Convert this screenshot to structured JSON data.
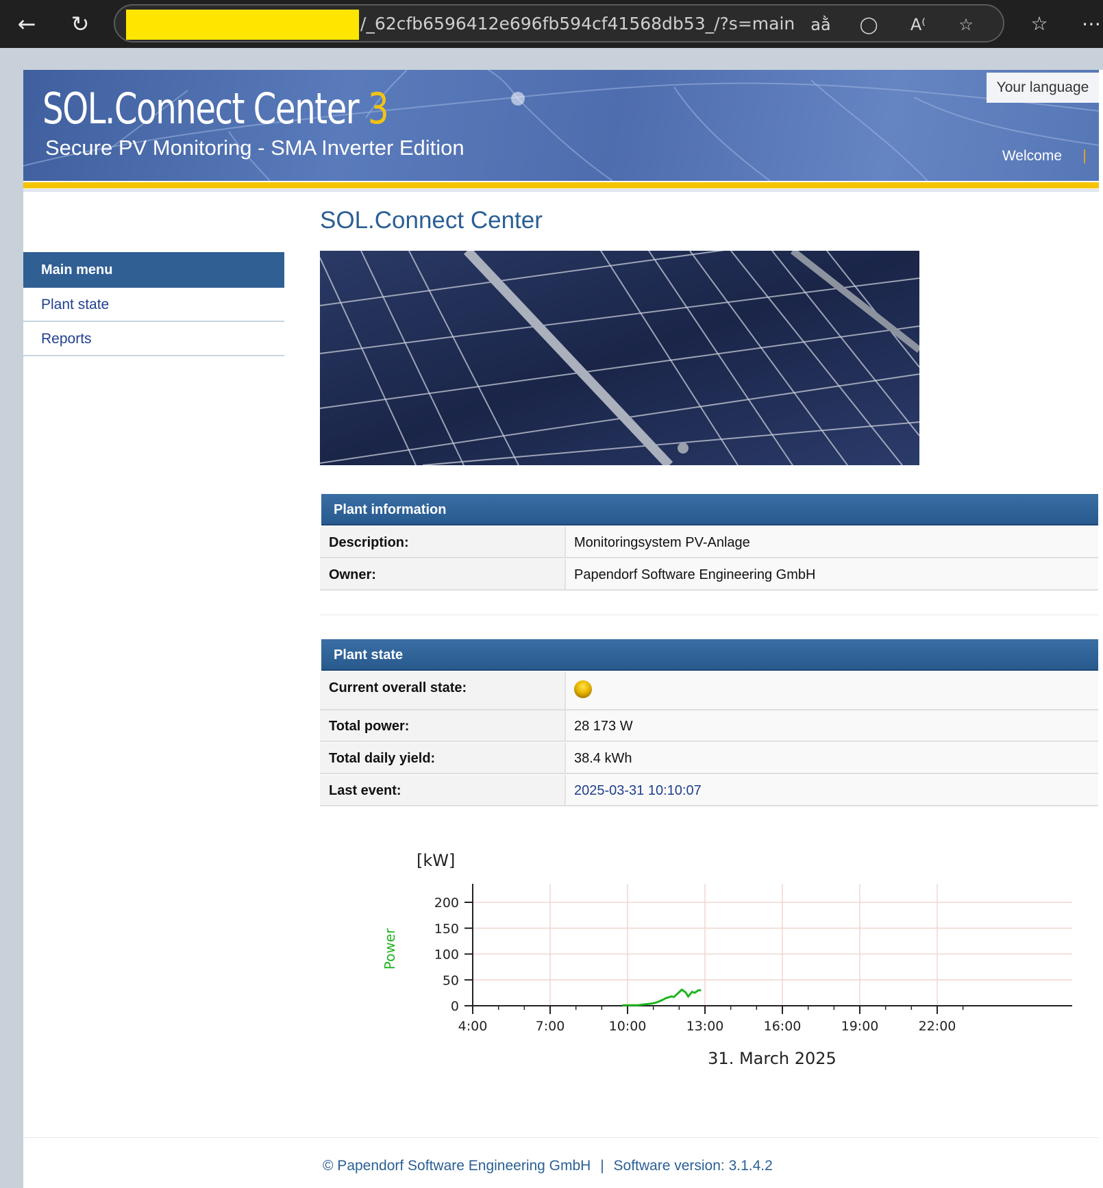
{
  "browser": {
    "url_visible": "/_62cfb6596412e696fb594cf41568db53_/?s=main",
    "url_redacted_color": "#ffe600"
  },
  "header": {
    "brand": "SOL.Connect Center ",
    "brand_version": "3",
    "tagline": "Secure PV Monitoring - SMA Inverter Edition",
    "language_button": "Your language",
    "welcome": "Welcome",
    "welcome_separator": "|"
  },
  "sidebar": {
    "title": "Main menu",
    "items": [
      {
        "label": "Plant state"
      },
      {
        "label": "Reports"
      }
    ]
  },
  "main": {
    "title": "SOL.Connect Center",
    "plant_information": {
      "heading": "Plant information",
      "rows": [
        {
          "label": "Description:",
          "value": "Monitoringsystem PV-Anlage"
        },
        {
          "label": "Owner:",
          "value": "Papendorf Software Engineering GmbH"
        }
      ]
    },
    "plant_state": {
      "heading": "Plant state",
      "rows": [
        {
          "label": "Current overall state:",
          "status_color": "#e9b400"
        },
        {
          "label": "Total power:",
          "value": "28 173 W"
        },
        {
          "label": "Total daily yield:",
          "value": "38.4 kWh"
        },
        {
          "label": "Last event:",
          "value": "2025-03-31 10:10:07"
        }
      ]
    }
  },
  "chart_data": {
    "type": "line",
    "unit_label": "[kW]",
    "ylabel": "Power",
    "xlabel": "31. March 2025",
    "x_ticks": [
      "4:00",
      "7:00",
      "10:00",
      "13:00",
      "16:00",
      "19:00",
      "22:00"
    ],
    "y_ticks": [
      "0",
      "50",
      "100",
      "150",
      "200"
    ],
    "ylim": [
      0,
      200
    ],
    "xlim_hours": [
      4,
      23
    ],
    "grid": true,
    "series": [
      {
        "color": "#1fb51f",
        "x_hours": [
          9.8,
          10.1,
          10.4,
          10.7,
          10.9,
          11.1,
          11.3,
          11.5,
          11.7,
          11.8,
          11.95,
          12.1,
          12.25,
          12.35,
          12.5,
          12.6,
          12.75,
          12.85
        ],
        "values": [
          1,
          1,
          1,
          3,
          4,
          6,
          10,
          15,
          18,
          17,
          24,
          31,
          26,
          18,
          27,
          25,
          30,
          30
        ]
      }
    ]
  },
  "footer": {
    "copyright": "© Papendorf Software Engineering GmbH",
    "separator": "|",
    "version": "Software version: 3.1.4.2"
  }
}
